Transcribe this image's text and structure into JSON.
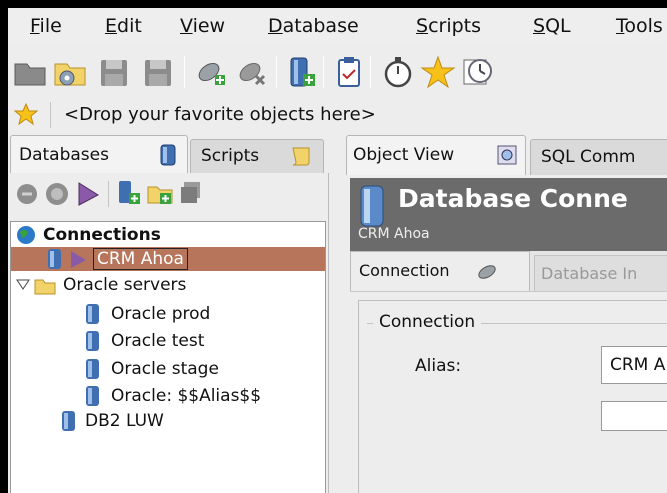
{
  "menu": [
    "File",
    "Edit",
    "View",
    "Database",
    "Scripts",
    "SQL",
    "Tools"
  ],
  "toolbar_icons": [
    "folder-gray-icon",
    "folder-gear-icon",
    "save-icon",
    "save-as-icon",
    "plug-connect-icon",
    "plug-disconnect-icon",
    "server-add-icon",
    "clipboard-icon",
    "stopwatch-icon",
    "star-icon",
    "clock-icon"
  ],
  "favorites_placeholder": "<Drop your favorite objects here>",
  "left_tabs": [
    {
      "label": "Databases"
    },
    {
      "label": "Scripts"
    }
  ],
  "tree": {
    "connections_label": "Connections",
    "selected": "CRM Ahoa",
    "oracle_group": "Oracle servers",
    "oracle_items": [
      "Oracle prod",
      "Oracle test",
      "Oracle stage",
      "Oracle: $$Alias$$"
    ],
    "partial": "DB2 LUW"
  },
  "right_tabs": [
    {
      "label": "Object View"
    },
    {
      "label": "SQL Comm"
    }
  ],
  "header": {
    "title": "Database Conne",
    "subtitle": "CRM Ahoa"
  },
  "sub_tabs": [
    {
      "label": "Connection"
    },
    {
      "label": "Database In"
    }
  ],
  "connection": {
    "group_label": "Connection",
    "alias_label": "Alias:",
    "alias_value": "CRM A"
  },
  "colors": {
    "selected_row": "#b7755c",
    "header_bg": "#6b6b6b",
    "menubar_bg": "#eeeeee"
  }
}
